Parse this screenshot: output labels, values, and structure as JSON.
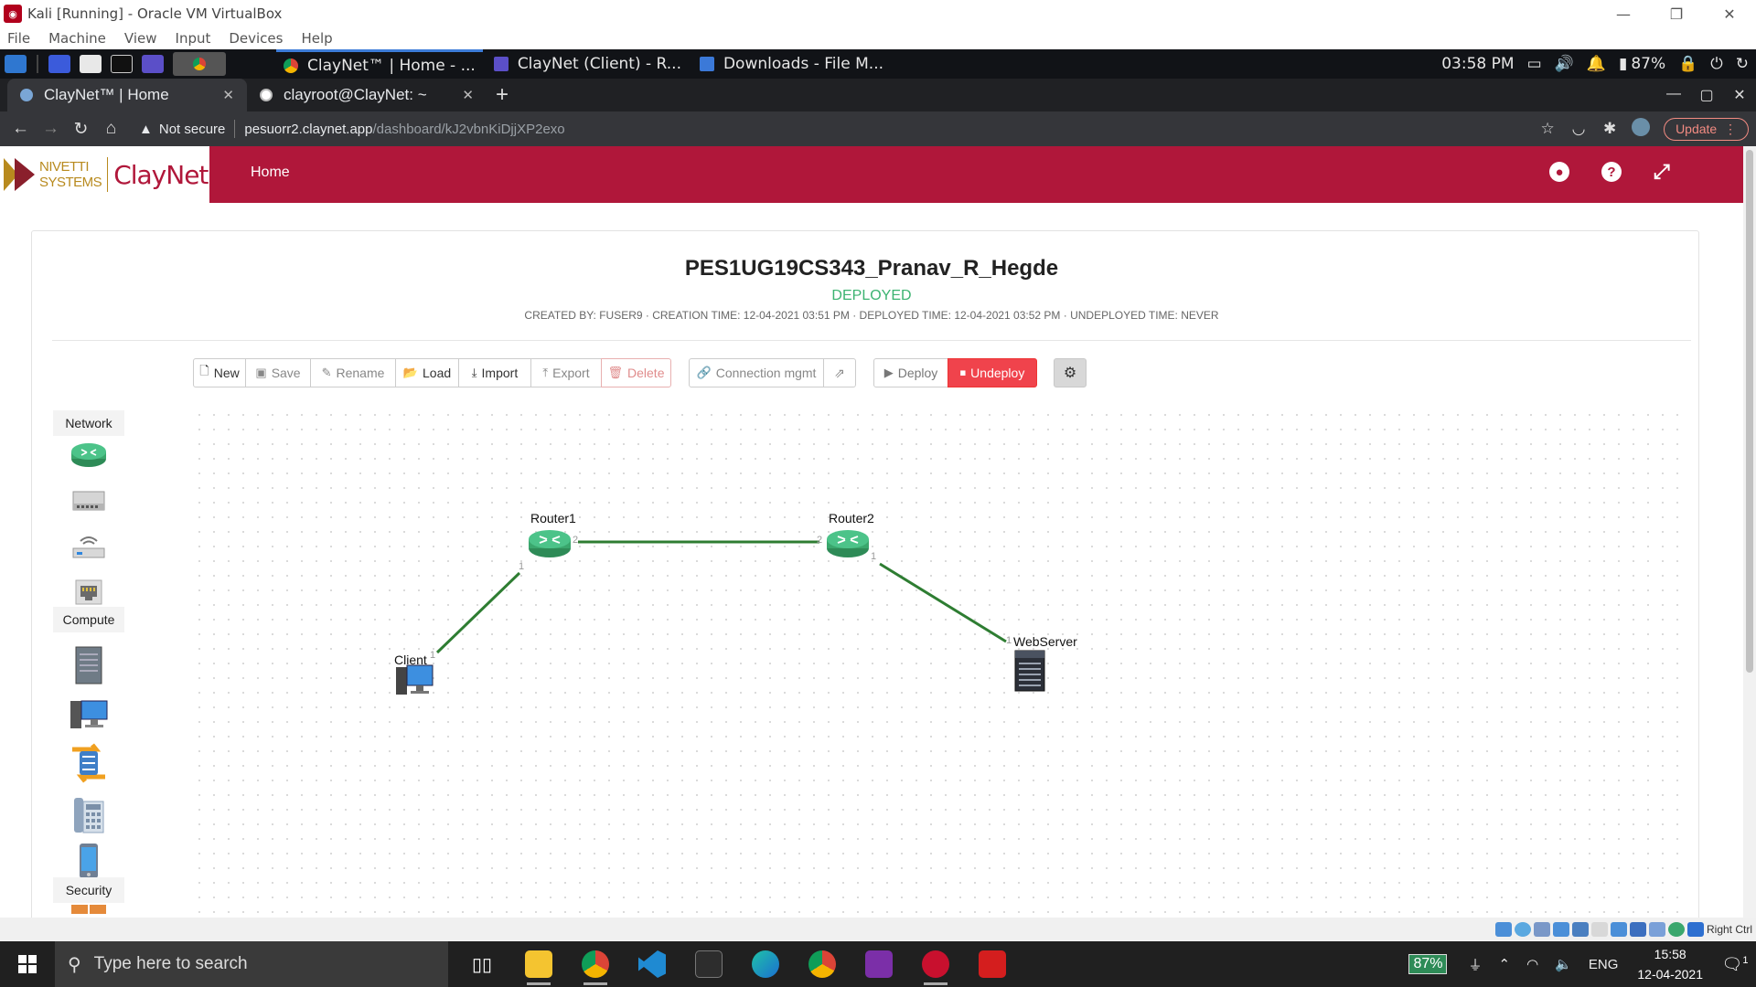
{
  "vbox": {
    "title": "Kali [Running] - Oracle VM VirtualBox",
    "menu": [
      "File",
      "Machine",
      "View",
      "Input",
      "Devices",
      "Help"
    ],
    "status_right": "Right Ctrl"
  },
  "kali_panel": {
    "tasks": [
      {
        "label": "ClayNet™ | Home - ..."
      },
      {
        "label": "ClayNet (Client) - R..."
      },
      {
        "label": "Downloads - File M..."
      }
    ],
    "time": "03:58 PM",
    "battery": "87%"
  },
  "chrome": {
    "tabs": [
      {
        "title": "ClayNet™ | Home"
      },
      {
        "title": "clayroot@ClayNet: ~"
      }
    ],
    "security_label": "Not secure",
    "url_host": "pesuorr2.claynet.app",
    "url_path": "/dashboard/kJ2vbnKiDjjXP2exo",
    "update_label": "Update"
  },
  "app": {
    "logo_line1": "NIVETTI",
    "logo_line2": "SYSTEMS",
    "logo_brand": "ClayNet",
    "nav_home": "Home"
  },
  "topology": {
    "name": "PES1UG19CS343_Pranav_R_Hegde",
    "status": "DEPLOYED",
    "meta": "CREATED BY: FUSER9 · CREATION TIME: 12-04-2021 03:51 PM · DEPLOYED TIME: 12-04-2021 03:52 PM · UNDEPLOYED TIME: NEVER"
  },
  "toolbar": {
    "new": "New",
    "save": "Save",
    "rename": "Rename",
    "load": "Load",
    "import": "Import",
    "export": "Export",
    "delete": "Delete",
    "connection": "Connection mgmt",
    "deploy": "Deploy",
    "undeploy": "Undeploy"
  },
  "palette": {
    "network": "Network",
    "compute": "Compute",
    "security": "Security"
  },
  "nodes": {
    "router1": "Router1",
    "router2": "Router2",
    "client": "Client",
    "webserver": "WebServer"
  },
  "ports": {
    "r1_right": "2",
    "r1_bottom": "1",
    "r2_left": "2",
    "r2_bottom": "1",
    "client": "1",
    "webserver": "1"
  },
  "taskbar": {
    "search_placeholder": "Type here to search",
    "battery": "87%",
    "lang": "ENG",
    "time": "15:58",
    "date": "12-04-2021",
    "notifications": "1"
  },
  "colors": {
    "brand": "#b0173a",
    "deployed": "#3cb371",
    "undeploy": "#f0434c",
    "link": "#2e7d32"
  }
}
